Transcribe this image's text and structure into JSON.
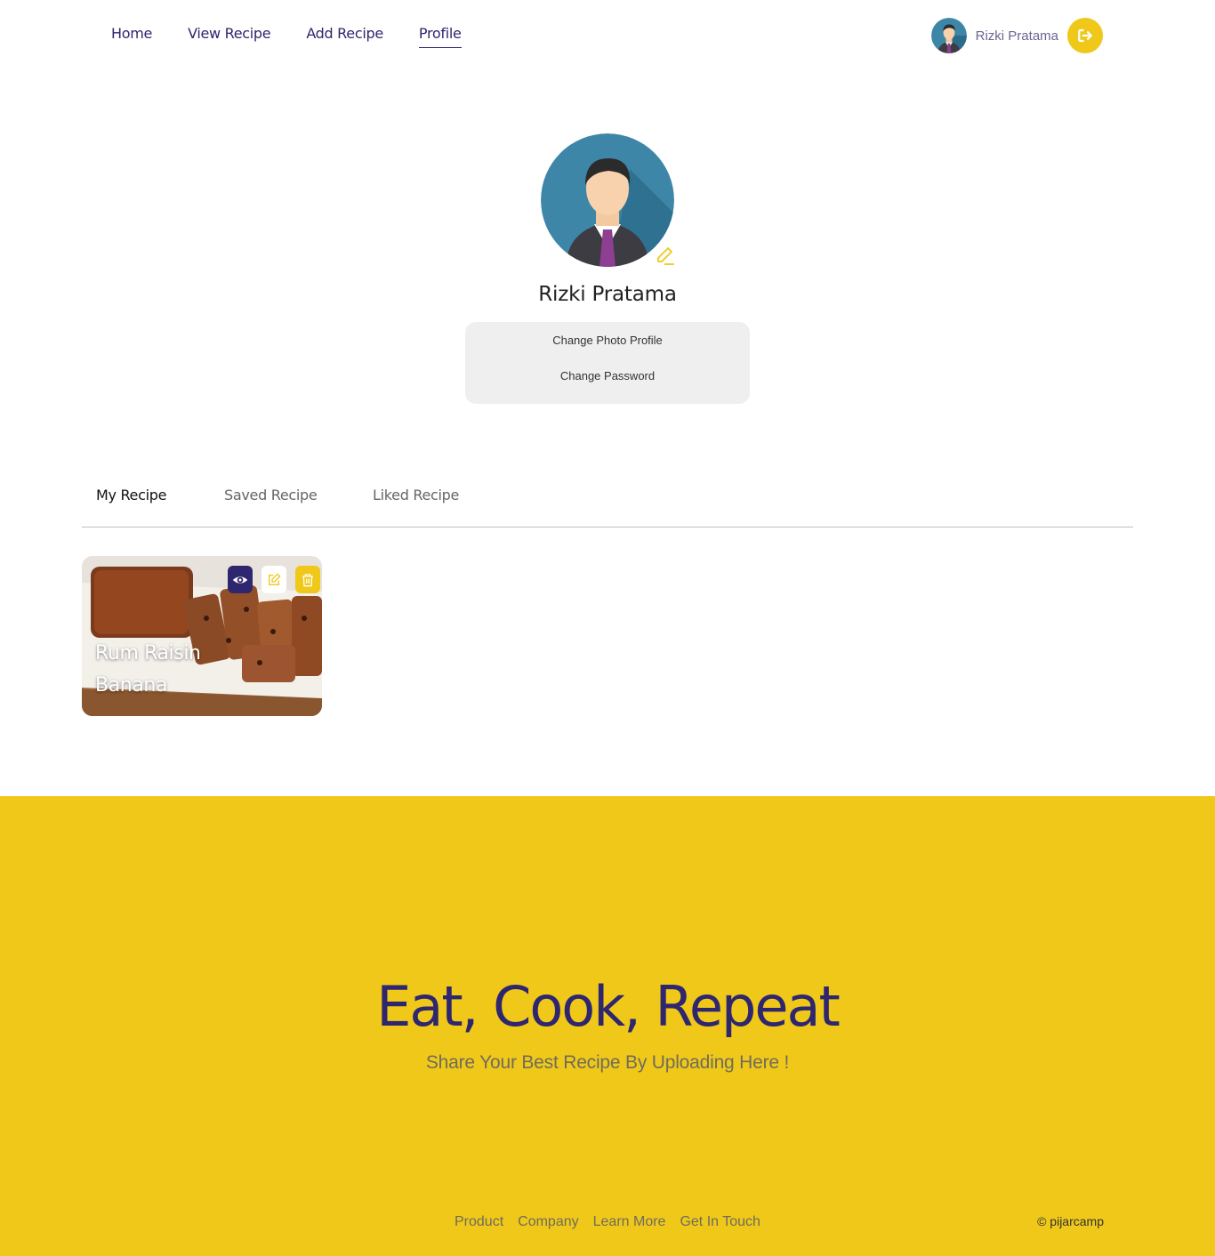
{
  "nav": {
    "links": [
      {
        "label": "Home"
      },
      {
        "label": "View Recipe"
      },
      {
        "label": "Add Recipe"
      },
      {
        "label": "Profile"
      }
    ],
    "user_name": "Rizki Pratama"
  },
  "profile": {
    "name": "Rizki Pratama",
    "menu": [
      "Change Photo Profile",
      "Change Password"
    ]
  },
  "tabs": [
    "My Recipe",
    "Saved Recipe",
    "Liked Recipe"
  ],
  "recipes": [
    {
      "title": "Rum Raisin Banana"
    }
  ],
  "footer": {
    "title": "Eat, Cook, Repeat",
    "subtitle": "Share Your Best Recipe By Uploading Here !",
    "links": [
      "Product",
      "Company",
      "Learn More",
      "Get In Touch"
    ],
    "copyright": "© pijarcamp"
  },
  "colors": {
    "brand_yellow": "#efc81a",
    "brand_navy": "#2e266f"
  }
}
